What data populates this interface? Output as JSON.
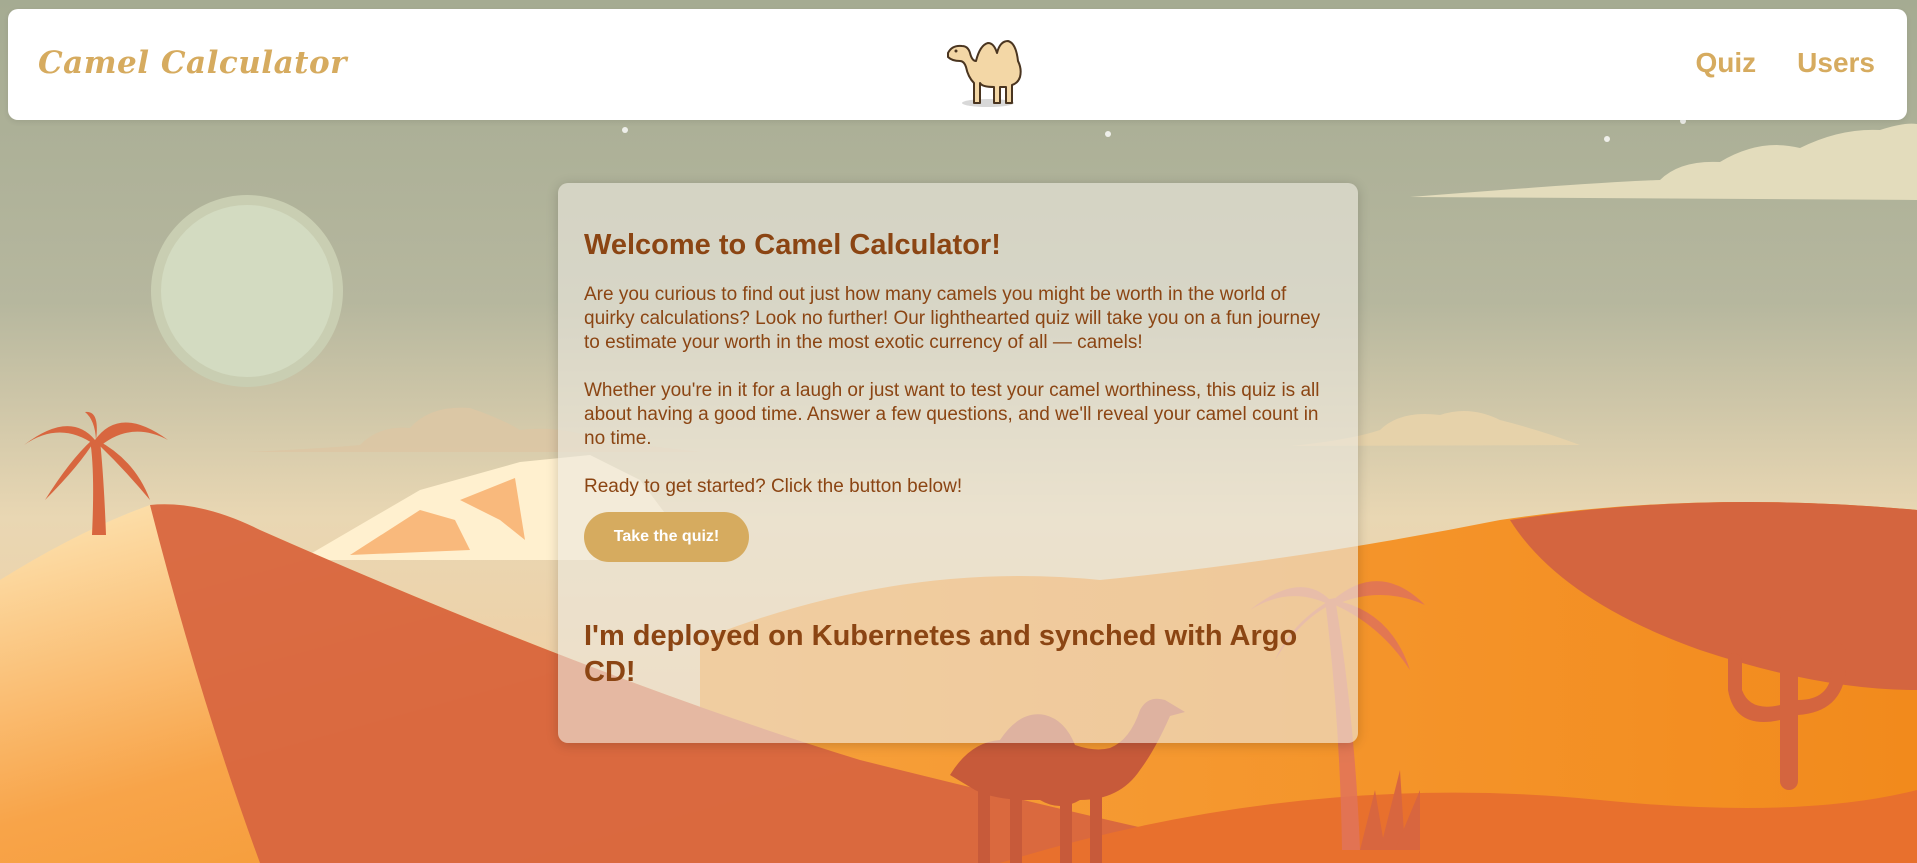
{
  "navbar": {
    "brand": "Camel Calculator",
    "links": [
      {
        "label": "Quiz"
      },
      {
        "label": "Users"
      }
    ]
  },
  "welcome": {
    "heading": "Welcome to Camel Calculator!",
    "paragraphs": [
      "Are you curious to find out just how many camels you might be worth in the world of quirky calculations? Look no further! Our lighthearted quiz will take you on a fun journey to estimate your worth in the most exotic currency of all — camels!",
      "Whether you're in it for a laugh or just want to test your camel worthiness, this quiz is all about having a good time. Answer a few questions, and we'll reveal your camel count in no time.",
      "Ready to get started? Click the button below!"
    ],
    "cta_label": "Take the quiz!",
    "deploy_note": "I'm deployed on Kubernetes and synched with Argo CD!"
  },
  "icons": {
    "logo": "camel-icon",
    "background": "desert-dunes-illustration"
  },
  "colors": {
    "accent": "#d6ab5f",
    "text": "#8b4513",
    "sky": "#a7ae93",
    "dune_orange": "#f4911f",
    "dune_dark": "#d4643f"
  }
}
